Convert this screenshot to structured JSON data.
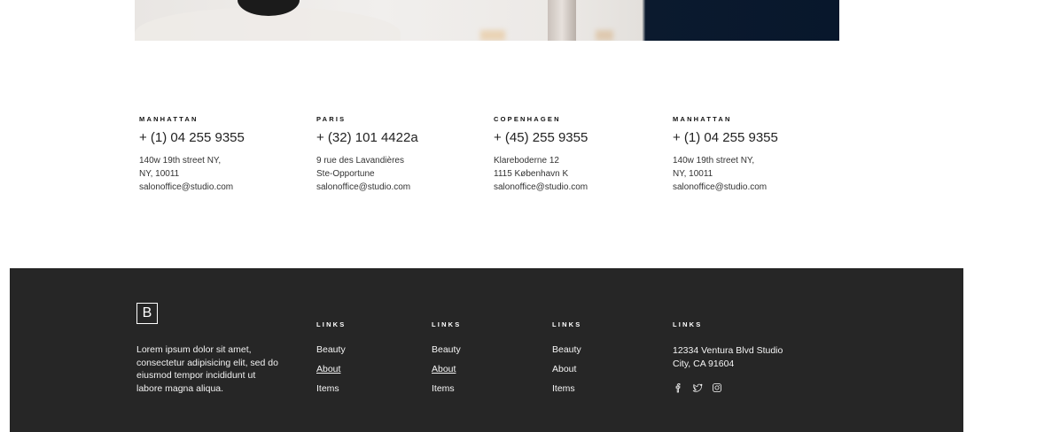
{
  "contacts": [
    {
      "city": "MANHATTAN",
      "phone": "+ (1) 04 255 9355",
      "lines": [
        "140w 19th street NY,",
        "NY, 10011",
        "salonoffice@studio.com"
      ]
    },
    {
      "city": "PARIS",
      "phone": "+ (32) 101 4422a",
      "lines": [
        "9 rue des Lavandières",
        "Ste-Opportune",
        "salonoffice@studio.com"
      ]
    },
    {
      "city": "COPENHAGEN",
      "phone": "+ (45) 255 9355",
      "lines": [
        "Klareboderne 12",
        "1115 København K",
        "salonoffice@studio.com"
      ]
    },
    {
      "city": "MANHATTAN",
      "phone": "+ (1) 04 255 9355",
      "lines": [
        "140w 19th street NY,",
        "NY, 10011",
        "salonoffice@studio.com"
      ]
    }
  ],
  "footer": {
    "logo": "B",
    "about": "Lorem ipsum dolor sit amet, consectetur adipisicing elit, sed do eiusmod tempor incididunt ut labore magna aliqua.",
    "columns": [
      {
        "heading": "LINKS",
        "links": [
          "Beauty",
          "About",
          "Items"
        ]
      },
      {
        "heading": "LINKS",
        "links": [
          "Beauty",
          "About",
          "Items"
        ]
      },
      {
        "heading": "LINKS",
        "links": [
          "Beauty",
          "About",
          "Items"
        ]
      }
    ],
    "contact": {
      "heading": "LINKS",
      "address_lines": [
        "12334 Ventura Blvd Studio",
        "City, CA 91604"
      ],
      "socials": [
        "facebook-icon",
        "twitter-icon",
        "instagram-icon"
      ]
    }
  },
  "colors": {
    "footer_bg": "#262626",
    "text": "#222222"
  }
}
